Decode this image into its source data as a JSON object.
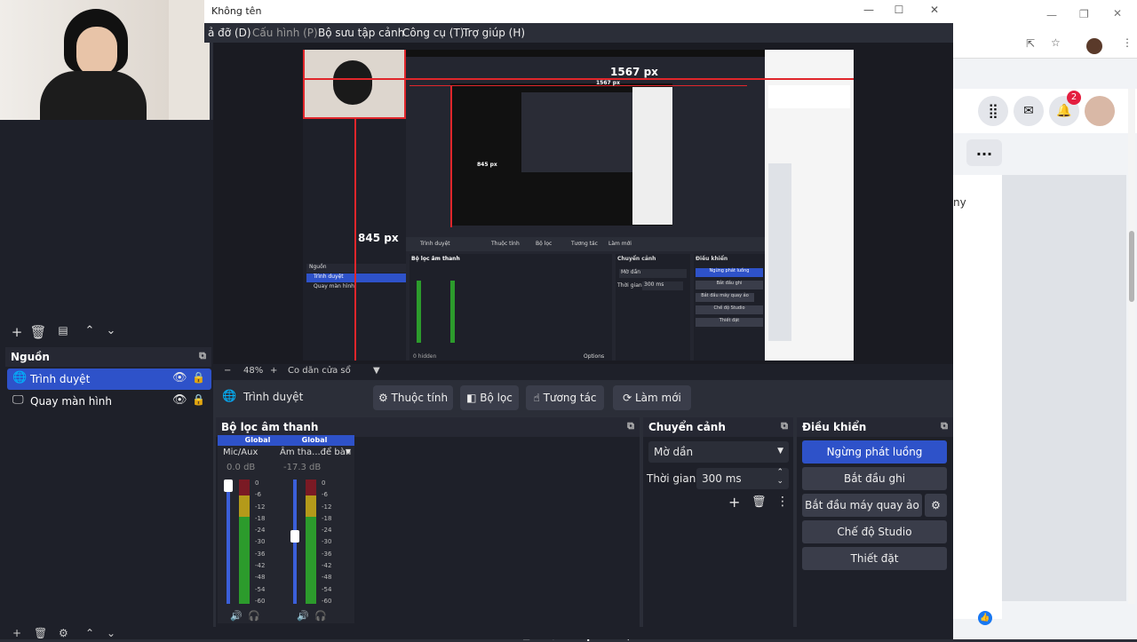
{
  "window": {
    "title": "Không tên"
  },
  "menu": [
    "ả đỡ (D)",
    "Cấu hình (P)",
    "Bộ sưu tập cảnh",
    "Công cụ (T)",
    "Trợ giúp (H)"
  ],
  "preview": {
    "label_width": "1567 px",
    "label_height": "845 px",
    "inner_label_width": "1567 px",
    "inner_label_height": "845 px",
    "inner_sources_header": "Nguồn",
    "inner_source_1": "Trình duyệt",
    "inner_source_2": "Quay màn hình",
    "inner_ctx_source": "Trình duyệt",
    "inner_ctx_props": "Thuộc tính",
    "inner_ctx_filters": "Bộ lọc",
    "inner_ctx_interact": "Tương tác",
    "inner_ctx_refresh": "Làm mới",
    "inner_mixer": "Bộ lọc âm thanh",
    "inner_trans": "Chuyển cảnh",
    "inner_trans_sel": "Mờ dần",
    "inner_duration_label": "Thời gian",
    "inner_duration": "300 ms",
    "inner_controls": "Điều khiển",
    "inner_btn_stop": "Ngừng phát luồng",
    "inner_btn_rec": "Bắt đầu ghi",
    "inner_btn_vcam": "Bắt đầu máy quay ảo",
    "inner_btn_studio": "Chế độ Studio",
    "inner_btn_settings": "Thiết đặt",
    "inner_hidden": "0 hidden",
    "inner_options": "Options"
  },
  "zoom": {
    "minus": "−",
    "value": "48%",
    "plus": "+",
    "fit": "Co dãn cửa sổ"
  },
  "sources": {
    "header": "Nguồn",
    "items": [
      {
        "name": "Trình duyệt",
        "selected": true
      },
      {
        "name": "Quay màn hình",
        "selected": false
      }
    ]
  },
  "context": {
    "source": "Trình duyệt",
    "properties": "Thuộc tính",
    "filters": "Bộ lọc",
    "interact": "Tương tác",
    "refresh": "Làm mới"
  },
  "mixer": {
    "header": "Bộ lọc âm thanh",
    "channels": [
      {
        "badge": "Global",
        "name": "Mic/Aux",
        "db": "0.0 dB",
        "fader": 1.0,
        "level": 0.95
      },
      {
        "badge": "Global",
        "name": "Âm tha...để bàn",
        "db": "-17.3 dB",
        "fader": 0.55,
        "level": 0.9
      }
    ],
    "scale": [
      "0",
      "-6",
      "-12",
      "-18",
      "-24",
      "-30",
      "-36",
      "-42",
      "-48",
      "-54",
      "-60"
    ],
    "hidden": "0 hidden",
    "options": "Options"
  },
  "transitions": {
    "header": "Chuyển cảnh",
    "selected": "Mờ dần",
    "duration_label": "Thời gian",
    "duration": "300 ms"
  },
  "controls": {
    "header": "Điều khiển",
    "stop_stream": "Ngừng phát luồng",
    "start_record": "Bắt đầu ghi",
    "start_vcam": "Bắt đầu máy quay ảo",
    "studio": "Chế độ Studio",
    "settings": "Thiết đặt"
  },
  "browser": {
    "notif_count": "2",
    "more": "...",
    "snippet": "ny"
  },
  "colors": {
    "accent": "#2e52c9",
    "red": "#e0262b",
    "panel": "#1e2029",
    "bg": "#2b2e38"
  }
}
